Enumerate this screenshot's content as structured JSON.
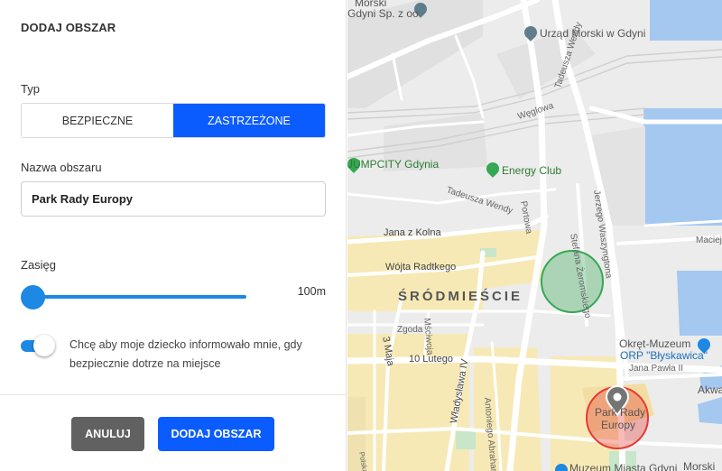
{
  "panel": {
    "title": "DODAJ OBSZAR",
    "type_label": "Typ",
    "type_options": [
      "BEZPIECZNE",
      "ZASTRZEŻONE"
    ],
    "type_selected": "ZASTRZEŻONE",
    "name_label": "Nazwa obszaru",
    "name_value": "Park Rady Europy",
    "range_label": "Zasięg",
    "range_value": "100m",
    "range_slider_level": 0,
    "notify_text": "Chcę aby moje dziecko informowało mnie, gdy bezpiecznie dotrze na miejsce",
    "notify_enabled": true,
    "cancel_label": "ANULUJ",
    "add_label": "DODAJ OBSZAR"
  },
  "colors": {
    "accent": "#0a5cff",
    "slider": "#1e88e5",
    "cancel": "#616161",
    "safe_zone": "#34a853",
    "restricted_zone": "#e53935",
    "water": "#a4c8f0",
    "old_town": "#f7e9b5"
  },
  "map": {
    "labels": {
      "company_top": "Morski",
      "company_line2": "Gdyni Sp. z oo",
      "urzad": "Urząd Morski w Gdyni",
      "jumpcity": "JUMPCITY Gdynia",
      "energy": "Energy Club",
      "district": "ŚRÓDMIEŚCIE",
      "okret1": "Okręt-Muzeum",
      "okret2": "ORP \"Błyskawica\"",
      "muzeum": "Muzeum Miasta Gdyni",
      "park1": "Park Rady",
      "park2": "Europy",
      "akwa": "Akwa",
      "wendy": "Tadeusza Wendy",
      "wendy2": "Tadeusza Wendy",
      "portowa": "Portowa",
      "weglowa": "Węglowa",
      "zeromskiego": "Stefana Żeromskiego",
      "waszyngtona": "Jerzego Waszyngtona",
      "kolna": "Jana z Kolna",
      "radtkego": "Wójta Radtkego",
      "maciej": "Macieje",
      "zgoda": "Zgoda",
      "mscu": "Mściwoja",
      "trzeciego": "3 Maja",
      "lutego": "10 Lutego",
      "wladyslawa": "Władysława IV",
      "abrahama": "Antoniego Abrahama",
      "pawla": "Jana Pawła II",
      "polska": "Polska",
      "morski": "Morski"
    },
    "icons": [
      "gov-pin-icon",
      "green-pin-icon",
      "map-marker-icon",
      "museum-pin-icon"
    ]
  }
}
